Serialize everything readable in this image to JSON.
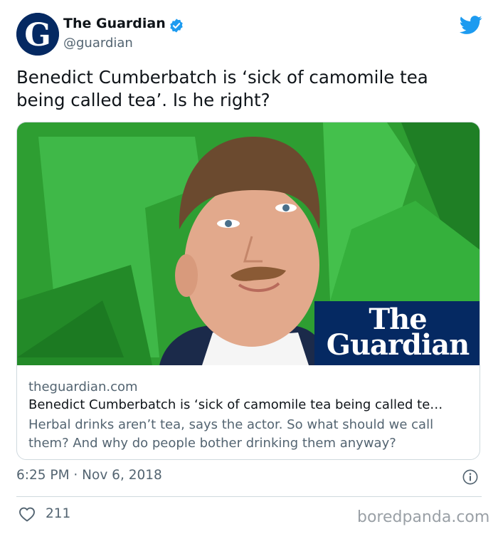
{
  "author": {
    "name": "The Guardian",
    "handle": "@guardian",
    "verified_icon": "verified-badge",
    "avatar_icon": "guardian-g-logo"
  },
  "tweet": {
    "text": "Benedict Cumberbatch is ‘sick of camomile tea being called tea’. Is he right?",
    "timestamp": "6:25 PM · Nov 6, 2018",
    "likes": "211"
  },
  "card": {
    "domain": "theguardian.com",
    "title": "Benedict Cumberbatch is ‘sick of camomile tea being called te…",
    "description": "Herbal drinks aren’t tea, says the actor. So what should we call them? And why do people bother drinking them anyway?",
    "brand_line1": "The",
    "brand_line2": "Guardian"
  },
  "watermark": "boredpanda.com",
  "colors": {
    "twitter_blue": "#1d9bf0",
    "guardian_navy": "#052962",
    "secondary_text": "#536471",
    "backdrop_green": "#2b9a2e"
  }
}
